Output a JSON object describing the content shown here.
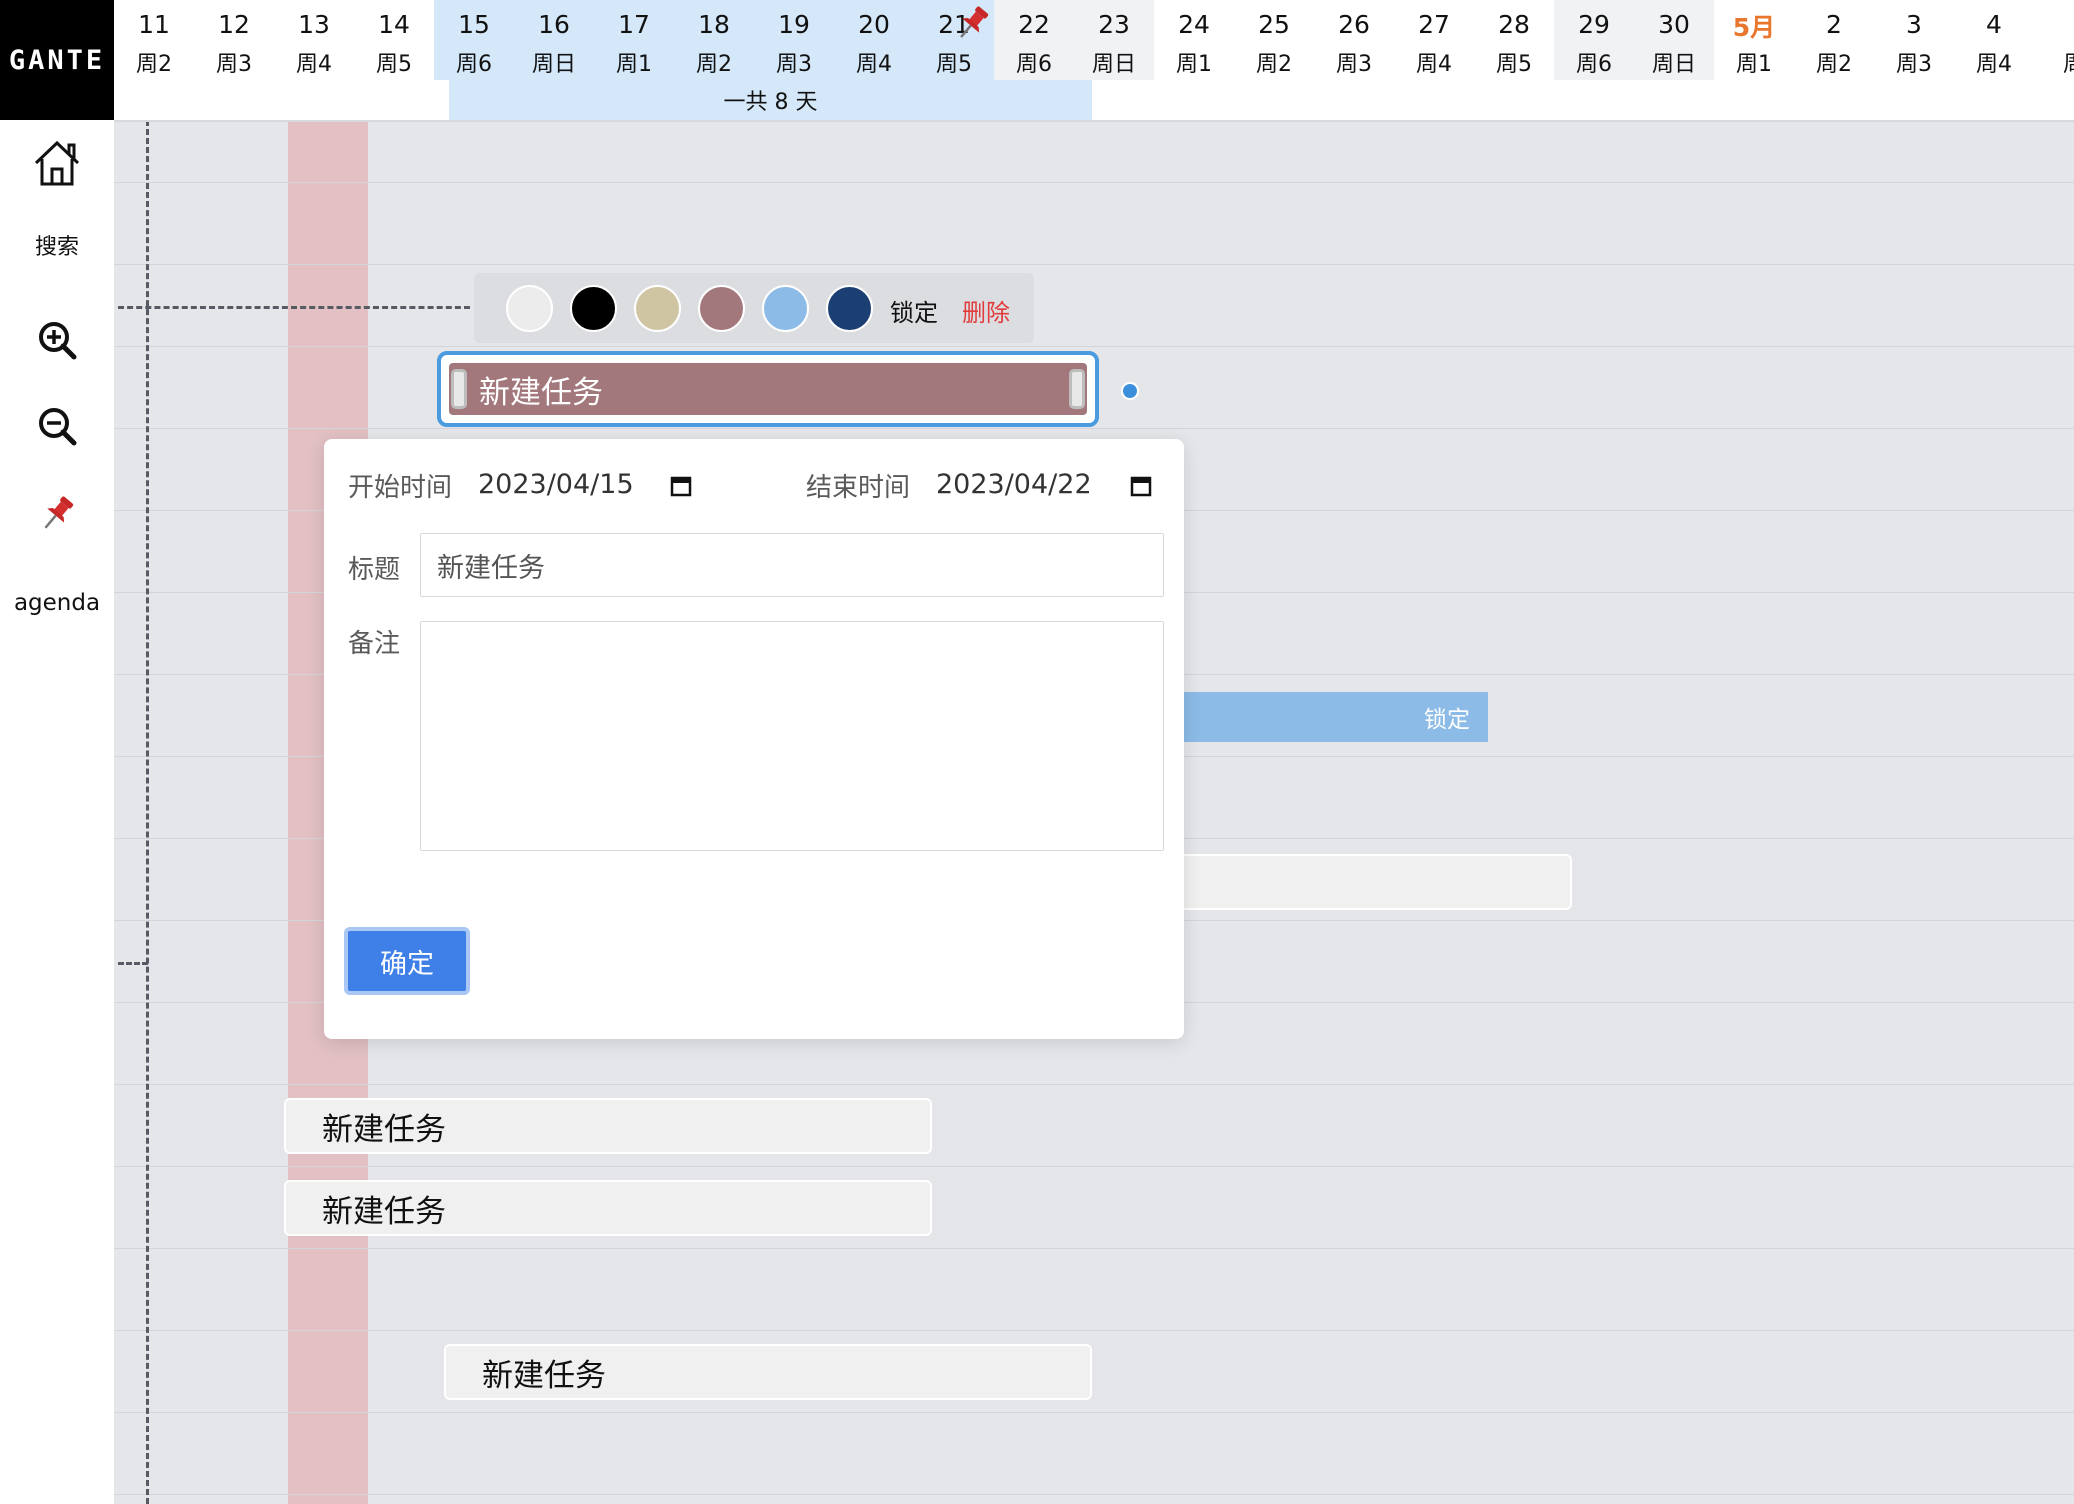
{
  "app": {
    "logo": "GANTE"
  },
  "sidebar": {
    "search_label": "搜索",
    "agenda_label": "agenda"
  },
  "header": {
    "days": [
      {
        "num": "11",
        "week": "周2"
      },
      {
        "num": "12",
        "week": "周3"
      },
      {
        "num": "13",
        "week": "周4"
      },
      {
        "num": "14",
        "week": "周5"
      },
      {
        "num": "15",
        "week": "周6"
      },
      {
        "num": "16",
        "week": "周日"
      },
      {
        "num": "17",
        "week": "周1"
      },
      {
        "num": "18",
        "week": "周2"
      },
      {
        "num": "19",
        "week": "周3"
      },
      {
        "num": "20",
        "week": "周4"
      },
      {
        "num": "21",
        "week": "周5"
      },
      {
        "num": "22",
        "week": "周6"
      },
      {
        "num": "23",
        "week": "周日"
      },
      {
        "num": "24",
        "week": "周1"
      },
      {
        "num": "25",
        "week": "周2"
      },
      {
        "num": "26",
        "week": "周3"
      },
      {
        "num": "27",
        "week": "周4"
      },
      {
        "num": "28",
        "week": "周5"
      },
      {
        "num": "29",
        "week": "周6"
      },
      {
        "num": "30",
        "week": "周日"
      },
      {
        "num": "5月",
        "week": "周1"
      },
      {
        "num": "2",
        "week": "周2"
      },
      {
        "num": "3",
        "week": "周3"
      },
      {
        "num": "4",
        "week": "周4"
      },
      {
        "num": "",
        "week": "周"
      }
    ],
    "range_label": "一共 8 天"
  },
  "toolbar": {
    "swatches": [
      "#ececec",
      "#000000",
      "#cfc5a2",
      "#a3787c",
      "#8bbbe6",
      "#1c3f73"
    ],
    "lock_label": "锁定",
    "delete_label": "删除"
  },
  "tasks": {
    "selected_title": "新建任务",
    "locked_label": "锁定",
    "task_a": "新建任务",
    "task_b": "新建任务",
    "task_c": "新建任务"
  },
  "modal": {
    "start_label": "开始时间",
    "start_value": "2023/04/15",
    "end_label": "结束时间",
    "end_value": "2023/04/22",
    "title_label": "标题",
    "title_value": "新建任务",
    "note_label": "备注",
    "note_value": "",
    "confirm_label": "确定"
  }
}
